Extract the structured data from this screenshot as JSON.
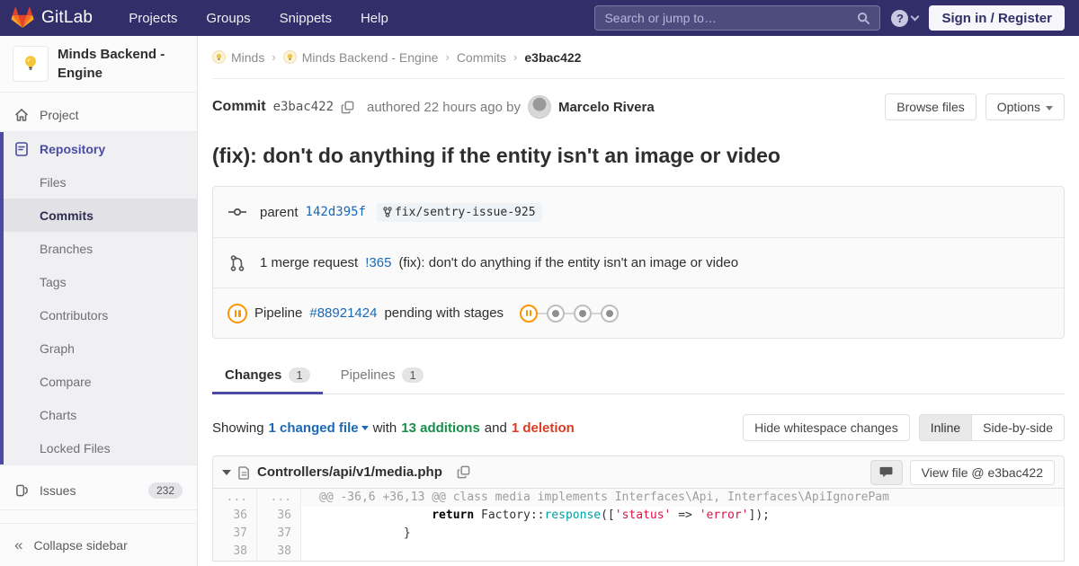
{
  "colors": {
    "navbar_bg": "#312e69",
    "brand_red": "#e24329",
    "brand_orange": "#fc6d26",
    "brand_yellow": "#fca326",
    "link_blue": "#1b69b6",
    "active_purple": "#4b4ba3",
    "addition_green": "#168f48",
    "deletion_red": "#db3b21",
    "pending_orange": "#fc9403"
  },
  "navbar": {
    "logo_text": "GitLab",
    "menu": {
      "projects": "Projects",
      "groups": "Groups",
      "snippets": "Snippets",
      "help": "Help"
    },
    "search_placeholder": "Search or jump to…",
    "help_glyph": "?",
    "sign_in_label": "Sign in / Register"
  },
  "sidebar": {
    "project_title": "Minds Backend - Engine",
    "project_label": "Project",
    "repository_label": "Repository",
    "repo_items": [
      "Files",
      "Commits",
      "Branches",
      "Tags",
      "Contributors",
      "Graph",
      "Compare",
      "Charts",
      "Locked Files"
    ],
    "active_repo_item": "Commits",
    "issues_label": "Issues",
    "issues_count": "232",
    "collapse_label": "Collapse sidebar"
  },
  "breadcrumb": {
    "crumb1": "Minds",
    "crumb2": "Minds Backend - Engine",
    "crumb3": "Commits",
    "current": "e3bac422"
  },
  "commit": {
    "label": "Commit",
    "hash": "e3bac422",
    "authored": "authored 22 hours ago by",
    "author": "Marcelo Rivera",
    "browse_files": "Browse files",
    "options": "Options",
    "title": "(fix): don't do anything if the entity isn't an image or video"
  },
  "commit_box": {
    "parent_label": "parent",
    "parent_hash": "142d395f",
    "branch": "fix/sentry-issue-925",
    "mr_prefix": "1 merge request",
    "mr_ref": "!365",
    "mr_title": "(fix): don't do anything if the entity isn't an image or video",
    "pipeline_label": "Pipeline",
    "pipeline_id": "#88921424",
    "pipeline_status": "pending with stages",
    "stages": [
      "paused",
      "created",
      "created",
      "created"
    ]
  },
  "tabs": {
    "changes": "Changes",
    "changes_count": "1",
    "pipelines": "Pipelines",
    "pipelines_count": "1"
  },
  "summary": {
    "showing": "Showing",
    "changed_file": "1 changed file",
    "with": "with",
    "additions": "13 additions",
    "and": "and",
    "deletions": "1 deletion",
    "hide_whitespace": "Hide whitespace changes",
    "inline": "Inline",
    "side_by_side": "Side-by-side"
  },
  "diff": {
    "file_path": "Controllers/api/v1/media.php",
    "view_file": "View file @ e3bac422",
    "hunk": {
      "old": "...",
      "new": "...",
      "text": "@@ -36,6 +36,13 @@ class media implements Interfaces\\Api, Interfaces\\ApiIgnorePam"
    },
    "row1": {
      "old": "36",
      "new": "36",
      "indent": "                ",
      "kw": "return",
      "t1": " Factory::",
      "fn": "response",
      "t2": "([",
      "s1": "'status'",
      "t3": " => ",
      "s2": "'error'",
      "t4": "]);"
    },
    "row2": {
      "old": "37",
      "new": "37",
      "code": "            }"
    },
    "row3": {
      "old": "38",
      "new": "38",
      "code": ""
    }
  }
}
